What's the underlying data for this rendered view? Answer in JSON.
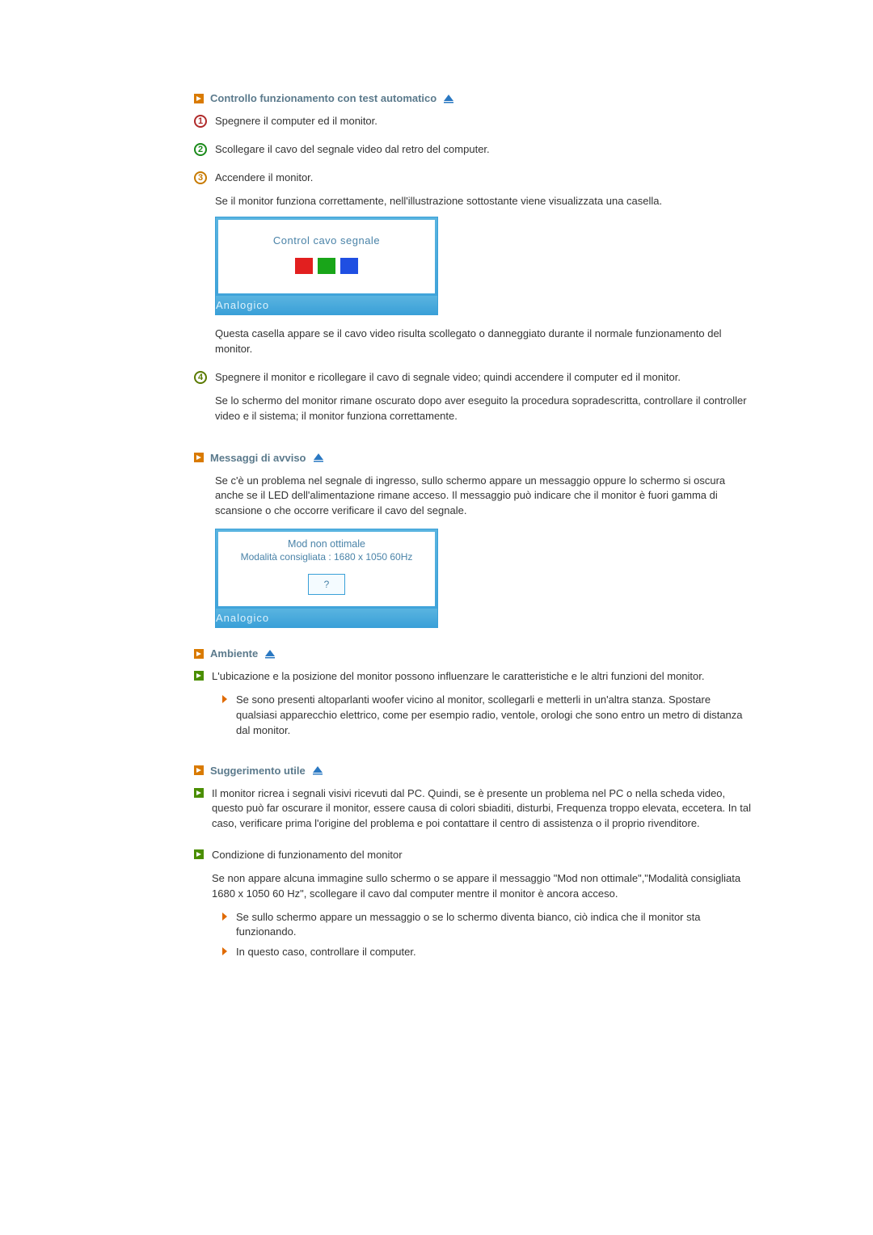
{
  "s1": {
    "title": "Controllo funzionamento con test automatico",
    "step1": "Spegnere il computer ed il monitor.",
    "step2": "Scollegare il cavo del segnale video dal retro del computer.",
    "step3": "Accendere il monitor.",
    "step3_after": "Se il monitor funziona correttamente, nell'illustrazione sottostante viene visualizzata una casella.",
    "illus1_title": "Control cavo segnale",
    "illus1_bottom": "Analogico",
    "step3_post": "Questa casella appare se il cavo video risulta scollegato o danneggiato durante il normale funzionamento del monitor.",
    "step4": "Spegnere il monitor e ricollegare il cavo di segnale video; quindi accendere il computer ed il monitor.",
    "step4_after": "Se lo schermo del monitor rimane oscurato dopo aver eseguito la procedura sopradescritta, controllare il controller video e il sistema; il monitor funziona correttamente."
  },
  "s2": {
    "title": "Messaggi di avviso",
    "para": "Se c'è un problema nel segnale di ingresso, sullo schermo appare un messaggio oppure lo schermo si oscura anche se il LED dell'alimentazione rimane acceso. Il messaggio può indicare che il monitor è fuori gamma di scansione o che occorre verificare il cavo del segnale.",
    "illus2_line1": "Mod non ottimale",
    "illus2_line2": "Modalità consigliata : 1680 x 1050  60Hz",
    "illus2_q": "?",
    "illus2_bottom": "Analogico"
  },
  "s3": {
    "title": "Ambiente",
    "b1": "L'ubicazione e la posizione del monitor possono influenzare le caratteristiche e le altri funzioni del monitor.",
    "b1_sub1": "Se sono presenti altoparlanti woofer vicino al monitor, scollegarli e metterli in un'altra stanza. Spostare qualsiasi apparecchio elettrico, come per esempio radio, ventole, orologi che sono entro un metro di distanza dal monitor."
  },
  "s4": {
    "title": "Suggerimento utile",
    "b1": "Il monitor ricrea i segnali visivi ricevuti dal PC. Quindi, se è presente un problema nel PC o nella scheda video, questo può far oscurare il monitor, essere causa di colori sbiaditi, disturbi, Frequenza troppo elevata, eccetera. In tal caso, verificare prima l'origine del problema e poi contattare il centro di assistenza o il proprio rivenditore.",
    "b2": "Condizione di funzionamento del monitor",
    "b2_para": "Se non appare alcuna immagine sullo schermo o se appare il messaggio \"Mod non ottimale\",\"Modalità consigliata 1680 x 1050 60 Hz\", scollegare il cavo dal computer mentre il monitor è ancora acceso.",
    "b2_sub1": "Se sullo schermo appare un messaggio o se lo schermo diventa bianco, ciò indica che il monitor sta funzionando.",
    "b2_sub2": "In questo caso, controllare il computer."
  }
}
